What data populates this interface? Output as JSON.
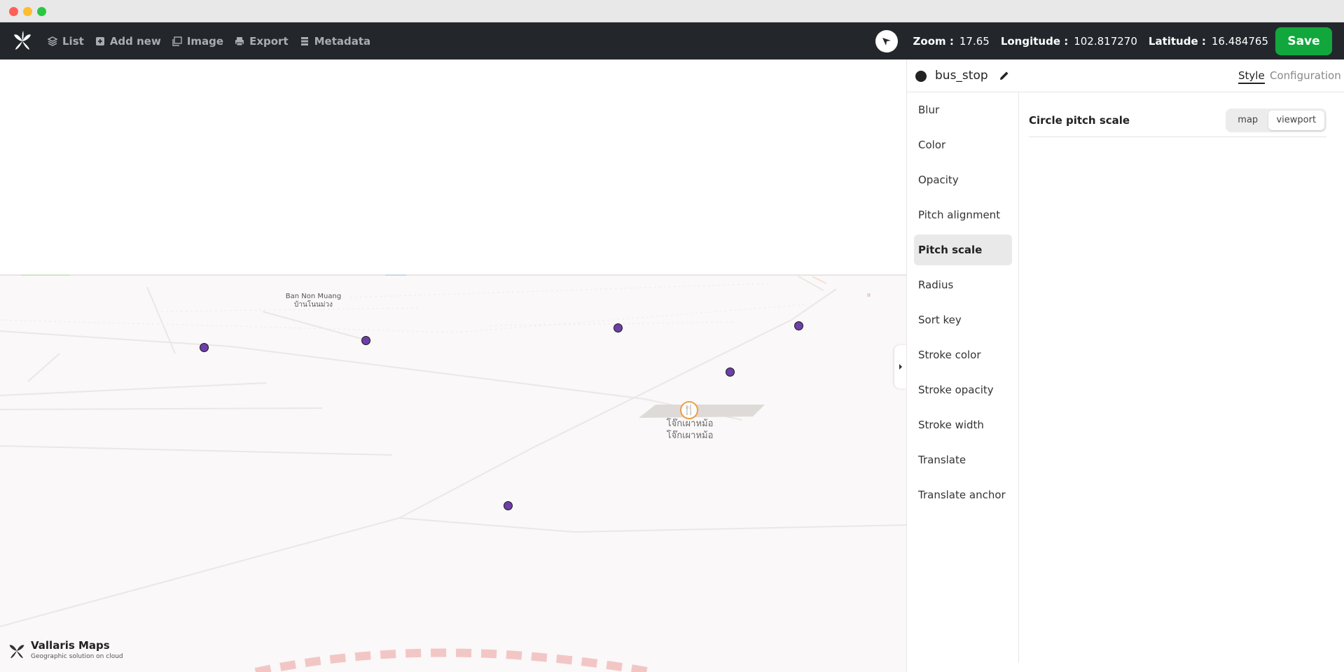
{
  "toolbar": {
    "nav": [
      {
        "label": "List",
        "icon": "layers-icon"
      },
      {
        "label": "Add new",
        "icon": "plus-square-icon"
      },
      {
        "label": "Image",
        "icon": "image-icon"
      },
      {
        "label": "Export",
        "icon": "printer-icon"
      },
      {
        "label": "Metadata",
        "icon": "list-icon"
      }
    ],
    "zoom_label": "Zoom :",
    "zoom_value": "17.65",
    "lon_label": "Longitude :",
    "lon_value": "102.817270",
    "lat_label": "Latitude :",
    "lat_value": "16.484765",
    "save_label": "Save"
  },
  "map": {
    "place_label_en": "Ban Non Muang",
    "place_label_th": "บ้านโนนม่วง",
    "poi_label_1": "โจ๊กเผาหม้อ",
    "poi_label_2": "โจ๊กเผาหม้อ",
    "brand_title": "Vallaris Maps",
    "brand_subtitle": "Geographic solution on cloud",
    "bus_stop_color": "#6d3fa8"
  },
  "panel": {
    "layer_name": "bus_stop",
    "tabs": {
      "style": "Style",
      "configuration": "Configuration"
    },
    "properties": [
      "Blur",
      "Color",
      "Opacity",
      "Pitch alignment",
      "Pitch scale",
      "Radius",
      "Sort key",
      "Stroke color",
      "Stroke opacity",
      "Stroke width",
      "Translate",
      "Translate anchor"
    ],
    "active_property": "Pitch scale",
    "detail": {
      "label": "Circle pitch scale",
      "options": [
        "map",
        "viewport"
      ],
      "selected": "viewport"
    }
  },
  "colors": {
    "accent_save": "#11a73d",
    "toolbar_bg": "#23272b"
  }
}
